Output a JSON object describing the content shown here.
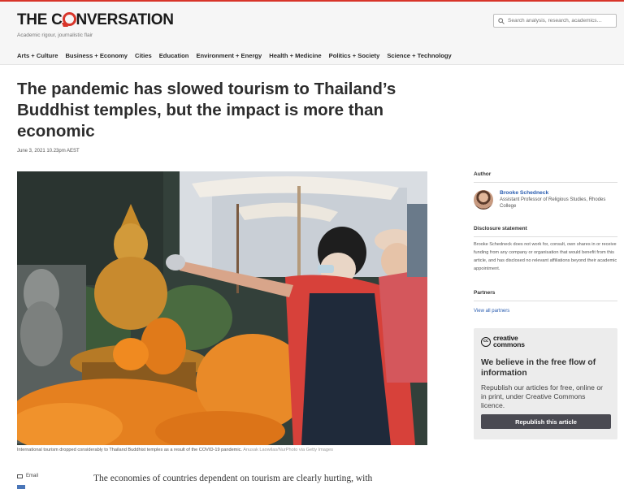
{
  "brand": {
    "logo_left": "THE C",
    "logo_right": "NVERSATION",
    "tagline": "Academic rigour, journalistic flair",
    "accent": "#d8352a"
  },
  "search": {
    "placeholder": "Search analysis, research, academics…",
    "icon": "search-icon"
  },
  "nav": [
    "Arts + Culture",
    "Business + Economy",
    "Cities",
    "Education",
    "Environment + Energy",
    "Health + Medicine",
    "Politics + Society",
    "Science + Technology"
  ],
  "article": {
    "title": "The pandemic has slowed tourism to Thailand’s Buddhist temples, but the impact is more than economic",
    "date": "June 3, 2021 10.23pm AEST",
    "caption": "International tourism dropped considerably to Thailand Buddhist temples as a result of the COVID-19 pandemic.",
    "credit": "Anusak Laowilas/NurPhoto via Getty Images",
    "body_start": "The economies of countries dependent on tourism are clearly hurting, with"
  },
  "share": {
    "email_label": "Email"
  },
  "sidebar": {
    "author_heading": "Author",
    "author_name": "Brooke Schedneck",
    "author_role": "Assistant Professor of Religious Studies, Rhodes College",
    "disclosure_heading": "Disclosure statement",
    "disclosure_text": "Brooke Schedneck does not work for, consult, own shares in or receive funding from any company or organisation that would benefit from this article, and has disclosed no relevant affiliations beyond their academic appointment.",
    "partners_heading": "Partners",
    "partners_link": "View all partners"
  },
  "cc": {
    "logo_top": "creative",
    "logo_bottom": "commons",
    "logo_mark": "cc",
    "heading": "We believe in the free flow of information",
    "body": "Republish our articles for free, online or in print, under Creative Commons licence.",
    "button": "Republish this article"
  }
}
